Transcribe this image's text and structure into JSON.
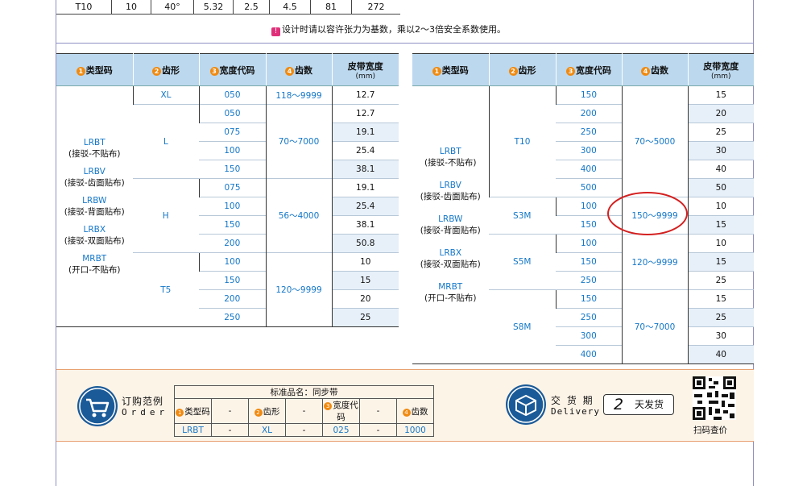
{
  "top_row": [
    "T10",
    "10",
    "40°",
    "5.32",
    "2.5",
    "4.5",
    "81",
    "272"
  ],
  "note": {
    "mark": "!",
    "text": "设计时请以容许张力为基数，乘以2～3倍安全系数使用。"
  },
  "headers": {
    "type": "类型码",
    "tooth": "齿形",
    "width_code": "宽度代码",
    "teeth": "齿数",
    "belt_width": "皮带宽度",
    "unit": "(mm)",
    "n1": "1",
    "n2": "2",
    "n3": "3",
    "n4": "4"
  },
  "types": [
    {
      "code": "LRBT",
      "desc": "(接驳-不贴布)"
    },
    {
      "code": "LRBV",
      "desc": "(接驳-齿面贴布)"
    },
    {
      "code": "LRBW",
      "desc": "(接驳-背面贴布)"
    },
    {
      "code": "LRBX",
      "desc": "(接驳-双面贴布)"
    },
    {
      "code": "MRBT",
      "desc": "(开口-不贴布)"
    }
  ],
  "left_table": {
    "groups": [
      {
        "tooth": "XL",
        "teeth": "118～9999",
        "rows": [
          {
            "w": "050",
            "bw": "12.7"
          }
        ]
      },
      {
        "tooth": "L",
        "teeth": "70～7000",
        "rows": [
          {
            "w": "050",
            "bw": "12.7"
          },
          {
            "w": "075",
            "bw": "19.1"
          },
          {
            "w": "100",
            "bw": "25.4"
          },
          {
            "w": "150",
            "bw": "38.1"
          }
        ]
      },
      {
        "tooth": "H",
        "teeth": "56～4000",
        "rows": [
          {
            "w": "075",
            "bw": "19.1"
          },
          {
            "w": "100",
            "bw": "25.4"
          },
          {
            "w": "150",
            "bw": "38.1"
          },
          {
            "w": "200",
            "bw": "50.8"
          }
        ]
      },
      {
        "tooth": "T5",
        "teeth": "120～9999",
        "rows": [
          {
            "w": "100",
            "bw": "10"
          },
          {
            "w": "150",
            "bw": "15"
          },
          {
            "w": "200",
            "bw": "20"
          },
          {
            "w": "250",
            "bw": "25"
          }
        ]
      }
    ]
  },
  "right_table": {
    "groups": [
      {
        "tooth": "T10",
        "teeth": "70～5000",
        "rows": [
          {
            "w": "150",
            "bw": "15"
          },
          {
            "w": "200",
            "bw": "20"
          },
          {
            "w": "250",
            "bw": "25"
          },
          {
            "w": "300",
            "bw": "30"
          },
          {
            "w": "400",
            "bw": "40"
          },
          {
            "w": "500",
            "bw": "50"
          }
        ]
      },
      {
        "tooth": "S3M",
        "teeth": "150～9999",
        "rows": [
          {
            "w": "100",
            "bw": "10"
          },
          {
            "w": "150",
            "bw": "15"
          }
        ]
      },
      {
        "tooth": "S5M",
        "teeth": "120～9999",
        "rows": [
          {
            "w": "100",
            "bw": "10"
          },
          {
            "w": "150",
            "bw": "15"
          },
          {
            "w": "250",
            "bw": "25"
          }
        ]
      },
      {
        "tooth": "S8M",
        "teeth": "70～7000",
        "rows": [
          {
            "w": "150",
            "bw": "15"
          },
          {
            "w": "250",
            "bw": "25"
          },
          {
            "w": "300",
            "bw": "30"
          },
          {
            "w": "400",
            "bw": "40"
          }
        ]
      }
    ]
  },
  "order": {
    "label_cn": "订购范例",
    "label_en": "Order",
    "product_title": "标准品名：同步带",
    "headers": [
      "类型码",
      "齿形",
      "宽度代码",
      "齿数"
    ],
    "values": [
      "LRBT",
      "XL",
      "025",
      "1000"
    ],
    "dash": "-"
  },
  "delivery": {
    "label_cn": "交 货 期",
    "label_en": "Delivery",
    "days": "2",
    "days_text": "天发货"
  },
  "scan": "扫码查价",
  "colors": {
    "accent": "#1477c8",
    "header_bg": "#bcd8ee",
    "badge": "#f08a10",
    "highlight_circle": "#d42020"
  }
}
